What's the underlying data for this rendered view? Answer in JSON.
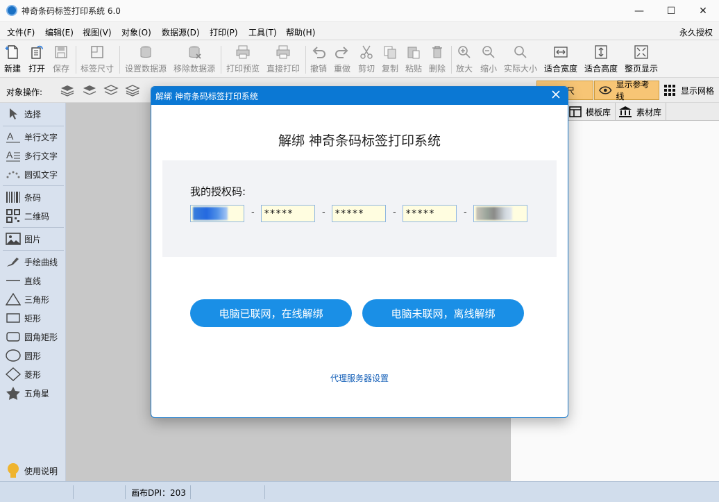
{
  "window": {
    "title": "神奇条码标签打印系统 6.0",
    "controls": {
      "minimize": "—",
      "maximize": "☐",
      "close": "✕"
    }
  },
  "menubar": {
    "items": [
      "文件(F)",
      "编辑(E)",
      "视图(V)",
      "对象(O)",
      "数据源(D)",
      "打印(P)",
      "工具(T)",
      "帮助(H)"
    ],
    "license": "永久授权"
  },
  "toolbar": {
    "new": "新建",
    "open": "打开",
    "save": "保存",
    "label_size": "标签尺寸",
    "set_datasource": "设置数据源",
    "remove_datasource": "移除数据源",
    "print_preview": "打印预览",
    "print_direct": "直接打印",
    "undo": "撤销",
    "redo": "重做",
    "cut": "剪切",
    "copy": "复制",
    "paste": "粘贴",
    "delete": "删除",
    "zoom_in": "放大",
    "zoom_out": "缩小",
    "actual_size": "实际大小",
    "fit_width": "适合宽度",
    "fit_height": "适合高度",
    "full_page": "整页显示"
  },
  "toolbar2": {
    "object_ops_label": "对象操作:",
    "show_ruler": "显示标尺",
    "show_guides": "显示参考线",
    "show_grid": "显示网格"
  },
  "sidebar": {
    "select": "选择",
    "single_text": "单行文字",
    "multi_text": "多行文字",
    "arc_text": "圆弧文字",
    "barcode": "条码",
    "qrcode": "二维码",
    "image": "图片",
    "freehand": "手绘曲线",
    "line": "直线",
    "triangle": "三角形",
    "rectangle": "矩形",
    "round_rect": "圆角矩形",
    "circle": "圆形",
    "diamond": "菱形",
    "star": "五角星",
    "help": "使用说明"
  },
  "right_panel": {
    "tabs": [
      "模板库",
      "素材库"
    ]
  },
  "status": {
    "dpi": "画布DPI：203"
  },
  "dialog": {
    "title": "解绑 神奇条码标签打印系统",
    "heading": "解绑 神奇条码标签打印系统",
    "code_label": "我的授权码:",
    "code_fields": [
      "",
      "*****",
      "*****",
      "*****",
      ""
    ],
    "dash": "-",
    "btn_online": "电脑已联网，在线解绑",
    "btn_offline": "电脑未联网，离线解绑",
    "proxy": "代理服务器设置"
  },
  "colors": {
    "accent": "#0b78d4",
    "pill": "#1a8fe6",
    "highlight": "#fcc978",
    "sidebar": "#dde6f3"
  }
}
